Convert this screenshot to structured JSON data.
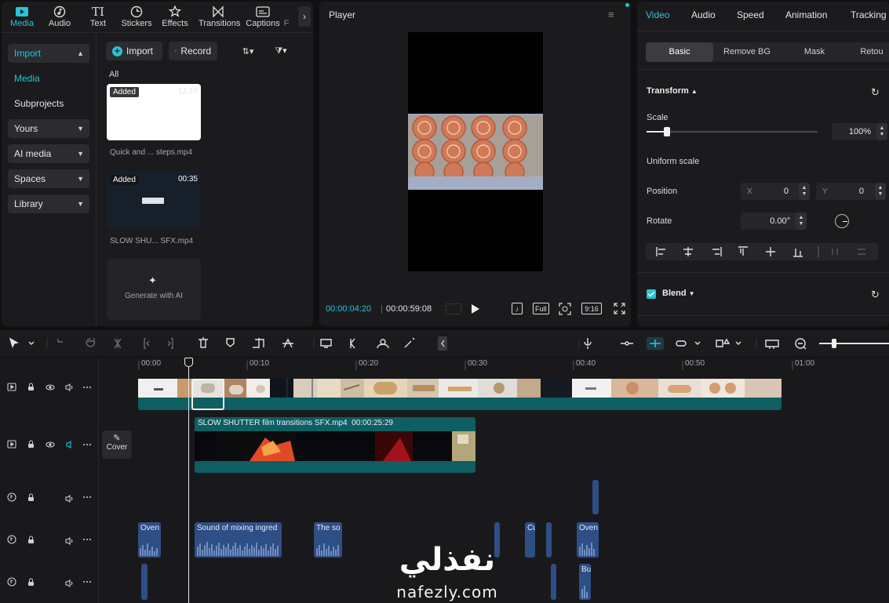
{
  "left_panel": {
    "tabs": [
      {
        "label": "Media",
        "icon": "media-icon",
        "active": true
      },
      {
        "label": "Audio",
        "icon": "audio-icon",
        "active": false
      },
      {
        "label": "Text",
        "icon": "text-icon",
        "active": false
      },
      {
        "label": "Stickers",
        "icon": "sticker-icon",
        "active": false
      },
      {
        "label": "Effects",
        "icon": "effects-icon",
        "active": false
      },
      {
        "label": "Transitions",
        "icon": "transitions-icon",
        "active": false
      },
      {
        "label": "Captions",
        "icon": "captions-icon",
        "active": false
      },
      {
        "label": "F",
        "icon": "filters-icon",
        "active": false
      }
    ],
    "sidebar": {
      "import_label": "Import",
      "media_label": "Media",
      "subprojects_label": "Subprojects",
      "yours_label": "Yours",
      "ai_media_label": "AI media",
      "spaces_label": "Spaces",
      "library_label": "Library"
    },
    "toolbar": {
      "import_label": "Import",
      "record_label": "Record"
    },
    "filter_all": "All",
    "media": [
      {
        "badge": "Added",
        "duration": "12:10",
        "name": "Quick and ... steps.mp4"
      },
      {
        "badge": "Added",
        "duration": "00:35",
        "name": "SLOW SHU... SFX.mp4"
      }
    ],
    "generate_label": "Generate with AI"
  },
  "player": {
    "title": "Player",
    "current_time": "00:00:04:20",
    "total_time": "00:00:59:08",
    "full_label": "Full",
    "ratio_label": "9:16"
  },
  "right_panel": {
    "tabs": [
      "Video",
      "Audio",
      "Speed",
      "Animation",
      "Tracking"
    ],
    "active_tab": "Video",
    "subtabs": [
      "Basic",
      "Remove BG",
      "Mask",
      "Retou"
    ],
    "transform_label": "Transform",
    "scale_label": "Scale",
    "scale_value": "100%",
    "scale_fraction": 0.12,
    "uniform_scale_label": "Uniform scale",
    "position_label": "Position",
    "pos_x_label": "X",
    "pos_x_value": "0",
    "pos_y_label": "Y",
    "pos_y_value": "0",
    "rotate_label": "Rotate",
    "rotate_value": "0.00°",
    "blend_label": "Blend",
    "accent_color": "#27c4d6"
  },
  "timeline": {
    "ticks": [
      "00:00",
      "00:10",
      "00:20",
      "00:30",
      "00:40",
      "00:50",
      "01:00"
    ],
    "cover_label": "Cover",
    "overlay_clip": {
      "name": "SLOW SHUTTER film transitions SFX.mp4",
      "duration": "00:00:25:29"
    },
    "audio_clips": [
      {
        "label": "Oven"
      },
      {
        "label": "Sound of mixing ingred"
      },
      {
        "label": "The so"
      },
      {
        "label": "Cu"
      },
      {
        "label": "Oven"
      },
      {
        "label": "Bu"
      }
    ]
  },
  "watermark": {
    "arabic": "نفذلي",
    "latin": "nafezly.com"
  }
}
